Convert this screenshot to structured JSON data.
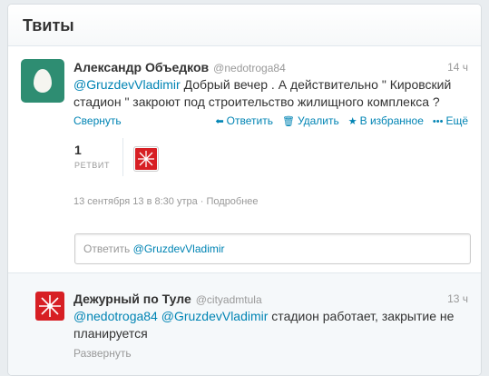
{
  "header": {
    "title": "Твиты"
  },
  "tweet": {
    "fullname": "Александр Объедков",
    "username": "@nedotroga84",
    "time": "14 ч",
    "mention": "@GruzdevVladimir",
    "text": " Добрый вечер . А действительно \" Кировский стадион \" закроют под строительство жилищного комплекса ?",
    "actions": {
      "collapse": "Свернуть",
      "reply": "Ответить",
      "delete": "Удалить",
      "favorite": "В избранное",
      "more": "Ещё"
    },
    "stats": {
      "retweet_count": "1",
      "retweet_label": "РЕТВИТ"
    },
    "date": "13 сентября 13 в 8:30 утра · Подробнее"
  },
  "reply_box": {
    "prefix": "Ответить ",
    "mention": "@GruzdevVladimir"
  },
  "reply_tweet": {
    "fullname": "Дежурный по Туле",
    "username": "@cityadmtula",
    "time": "13 ч",
    "mention1": "@nedotroga84",
    "mention2": "@GruzdevVladimir",
    "text": " стадион работает, закрытие не планируется",
    "expand": "Развернуть"
  },
  "colors": {
    "link": "#0084b4",
    "egg_bg": "#2e8d72",
    "tula_red": "#d71f24"
  },
  "icons": [
    "egg-avatar",
    "reply-arrow-icon",
    "trash-icon",
    "star-icon",
    "more-dots-icon",
    "tula-crest-icon"
  ]
}
